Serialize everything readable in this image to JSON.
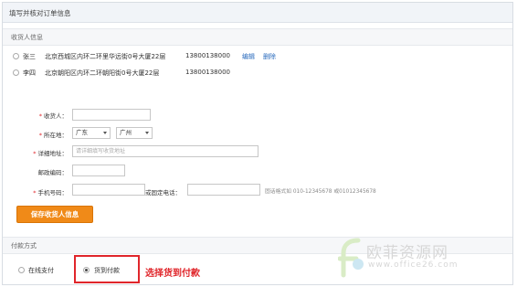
{
  "page": {
    "title": "填写并核对订单信息"
  },
  "consignee_section": {
    "title": "收货人信息"
  },
  "addresses": [
    {
      "name": "张三",
      "address": "北京西城区内环二环里华远街0号大厦22层",
      "phone": "13800138000",
      "edit_label": "编辑",
      "delete_label": "删除"
    },
    {
      "name": "李四",
      "address": "北京朝阳区内环二环朝阳街0号大厦22层",
      "phone": "13800138000"
    }
  ],
  "form": {
    "receiver_label": "收货人：",
    "region_label": "所在地：",
    "province": "广东",
    "city": "广州",
    "detail_label": "详细地址：",
    "detail_placeholder": "请详细填写收货地址",
    "postcode_label": "邮政编码：",
    "mobile_label": "手机号码：",
    "landline_label": "或固定电话：",
    "phone_hint": "固话格式如 010-12345678 或01012345678",
    "save_label": "保存收货人信息"
  },
  "payment_section": {
    "title": "付款方式",
    "online_label": "在线支付",
    "cod_label": "货到付款",
    "annotation": "选择货到付款"
  },
  "watermark": {
    "brand": "欧菲资源网",
    "url": "www.office26.com"
  },
  "colors": {
    "accent_orange": "#f08a18",
    "highlight_red": "#e0262b",
    "link_blue": "#2a6bbd"
  }
}
